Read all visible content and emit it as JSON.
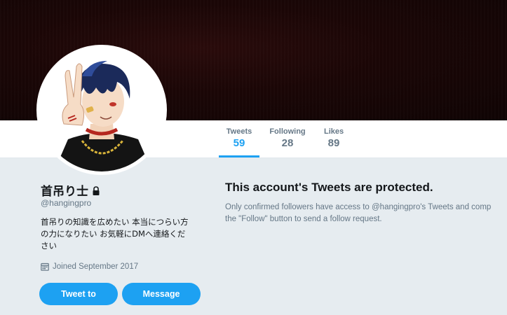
{
  "stats": {
    "tweets": {
      "label": "Tweets",
      "value": "59"
    },
    "following": {
      "label": "Following",
      "value": "28"
    },
    "likes": {
      "label": "Likes",
      "value": "89"
    }
  },
  "profile": {
    "display_name": "首吊り士",
    "handle": "@hangingpro",
    "bio_line1": "首吊りの知識を広めたい 本当につらい方",
    "bio_line2": "の力になりたい お気軽にDMへ連絡くだ",
    "bio_line3": "さい",
    "joined": "Joined September 2017"
  },
  "actions": {
    "tweet_to": "Tweet to",
    "message": "Message"
  },
  "protected": {
    "title": "This account's Tweets are protected.",
    "line1": "Only confirmed followers have access to @hangingpro's Tweets and comp",
    "line2": "the \"Follow\" button to send a follow request."
  },
  "colors": {
    "accent": "#1da1f2",
    "background": "#e6ecf0",
    "muted": "#657786"
  },
  "icons": [
    "lock-icon",
    "calendar-icon"
  ]
}
